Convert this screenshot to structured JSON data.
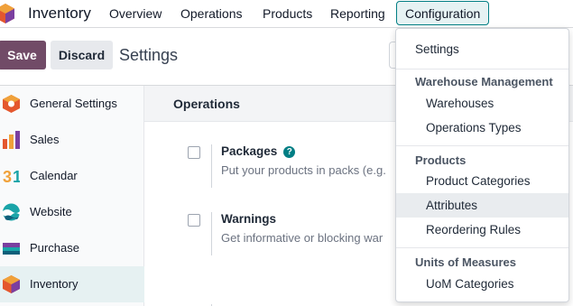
{
  "navbar": {
    "app_name": "Inventory",
    "menu": [
      "Overview",
      "Operations",
      "Products",
      "Reporting",
      "Configuration"
    ],
    "active_menu": "Configuration"
  },
  "control_panel": {
    "save_label": "Save",
    "discard_label": "Discard",
    "breadcrumb": "Settings"
  },
  "sidebar": {
    "items": [
      {
        "label": "General Settings",
        "icon": "settings-hexagon-icon"
      },
      {
        "label": "Sales",
        "icon": "sales-chart-icon"
      },
      {
        "label": "Calendar",
        "icon": "calendar-31-icon"
      },
      {
        "label": "Website",
        "icon": "website-wave-icon"
      },
      {
        "label": "Purchase",
        "icon": "purchase-card-icon"
      },
      {
        "label": "Inventory",
        "icon": "inventory-box-icon"
      }
    ],
    "active": "Inventory"
  },
  "main": {
    "section_title": "Operations",
    "settings": [
      {
        "title": "Packages",
        "description": "Put your products in packs (e.g.",
        "has_help": true,
        "checked": false
      },
      {
        "title": "Warnings",
        "description": "Get informative or blocking war",
        "has_help": false,
        "checked": false
      }
    ]
  },
  "dropdown": {
    "settings": "Settings",
    "warehouse_header": "Warehouse Management",
    "warehouses": "Warehouses",
    "operations_types": "Operations Types",
    "products_header": "Products",
    "product_categories": "Product Categories",
    "attributes": "Attributes",
    "reordering_rules": "Reordering Rules",
    "uom_header": "Units of Measures",
    "uom_categories": "UoM Categories",
    "hovered": "Attributes"
  },
  "colors": {
    "brand": "#714b67",
    "accent": "#017e84",
    "active_bg": "#e6f1f2"
  }
}
